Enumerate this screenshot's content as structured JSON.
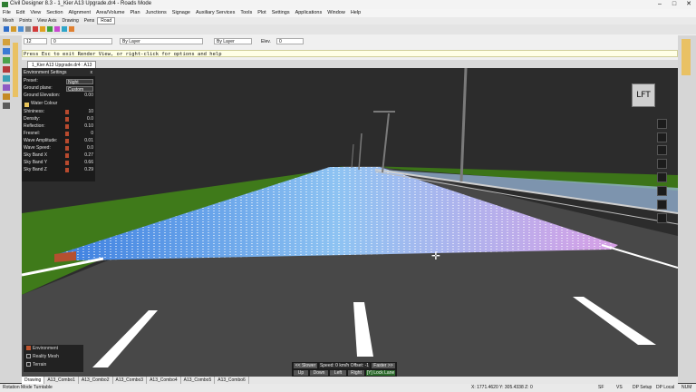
{
  "window": {
    "title": "Civil Designer 8.3 - 1_Kier A13 Upgrade.dr4 - Roads Mode",
    "min": "–",
    "max": "□",
    "close": "✕"
  },
  "menu": [
    "File",
    "Edit",
    "View",
    "Section",
    "Alignment",
    "Area/Volume",
    "Plan",
    "Junctions",
    "Signage",
    "Auxiliary Services",
    "Tools",
    "Plot",
    "Settings",
    "Applications",
    "Window",
    "Help"
  ],
  "mode_tabs": [
    "Mesh",
    "Points",
    "View Axis",
    "Drawing",
    "Pens",
    "Road"
  ],
  "active_mode_tab": "Road",
  "props": {
    "layer_value": "12",
    "pen_value": "0",
    "linetype_value": "By Layer",
    "colour_value": "By Layer",
    "elev_label": "Elev.",
    "elev_value": "0"
  },
  "hint": "Press Esc to exit Render View, or right-click for options and help",
  "doc_tab": "1_Kier A13 Upgrade.dr4 : A13",
  "view_cube": "LFT",
  "env": {
    "title": "Environment Settings",
    "close": "x",
    "preset_label": "Preset:",
    "preset_value": "Night",
    "ground_plane_label": "Ground plane:",
    "ground_plane_value": "Custom",
    "ground_elev_label": "Ground Elevation:",
    "ground_elev_value": "0.00",
    "water_colour_label": "Water Colour",
    "params": [
      {
        "label": "Shininess:",
        "value": "10"
      },
      {
        "label": "Density:",
        "value": "0.0"
      },
      {
        "label": "Reflection:",
        "value": "0.10"
      },
      {
        "label": "Fresnel:",
        "value": "0"
      },
      {
        "label": "Wave Amplitude:",
        "value": "0.01"
      },
      {
        "label": "Wave Speed:",
        "value": "0.0"
      },
      {
        "label": "Sky Band X",
        "value": "0.27"
      },
      {
        "label": "Sky Band Y",
        "value": "0.66"
      },
      {
        "label": "Sky Band Z",
        "value": "0.29"
      }
    ]
  },
  "layers": [
    {
      "label": "Environment",
      "checked": true
    },
    {
      "label": "Reality Mesh",
      "checked": false
    },
    {
      "label": "Terrain",
      "checked": false
    }
  ],
  "drive": {
    "slower": "<< Slower",
    "speed": "Speed: 0 km/h  Offset: -1",
    "faster": "Faster >>",
    "up": "Up",
    "down": "Down",
    "left": "Left",
    "right": "Right",
    "lock": "[Y] Lock Lane"
  },
  "bottom_tabs": [
    "Drawing",
    "A13_Combo1",
    "A13_Combo2",
    "A13_Combo3",
    "A13_Combo4",
    "A13_Combo5",
    "A13_Combo6"
  ],
  "status": {
    "left": "Rotation Mode Turntable",
    "coords": "X: 1771.4620 Y: 305.4338 Z: 0",
    "cells": [
      "SF",
      "VS",
      "DP Setup",
      "DP Local",
      "NUM"
    ]
  },
  "colors": {
    "sky": "#2a2a2a",
    "grass": "#3f7a1a",
    "asphalt": "#4a4a4a",
    "highlight_start": "#3d7fe0",
    "highlight_end": "#d79fe6"
  }
}
